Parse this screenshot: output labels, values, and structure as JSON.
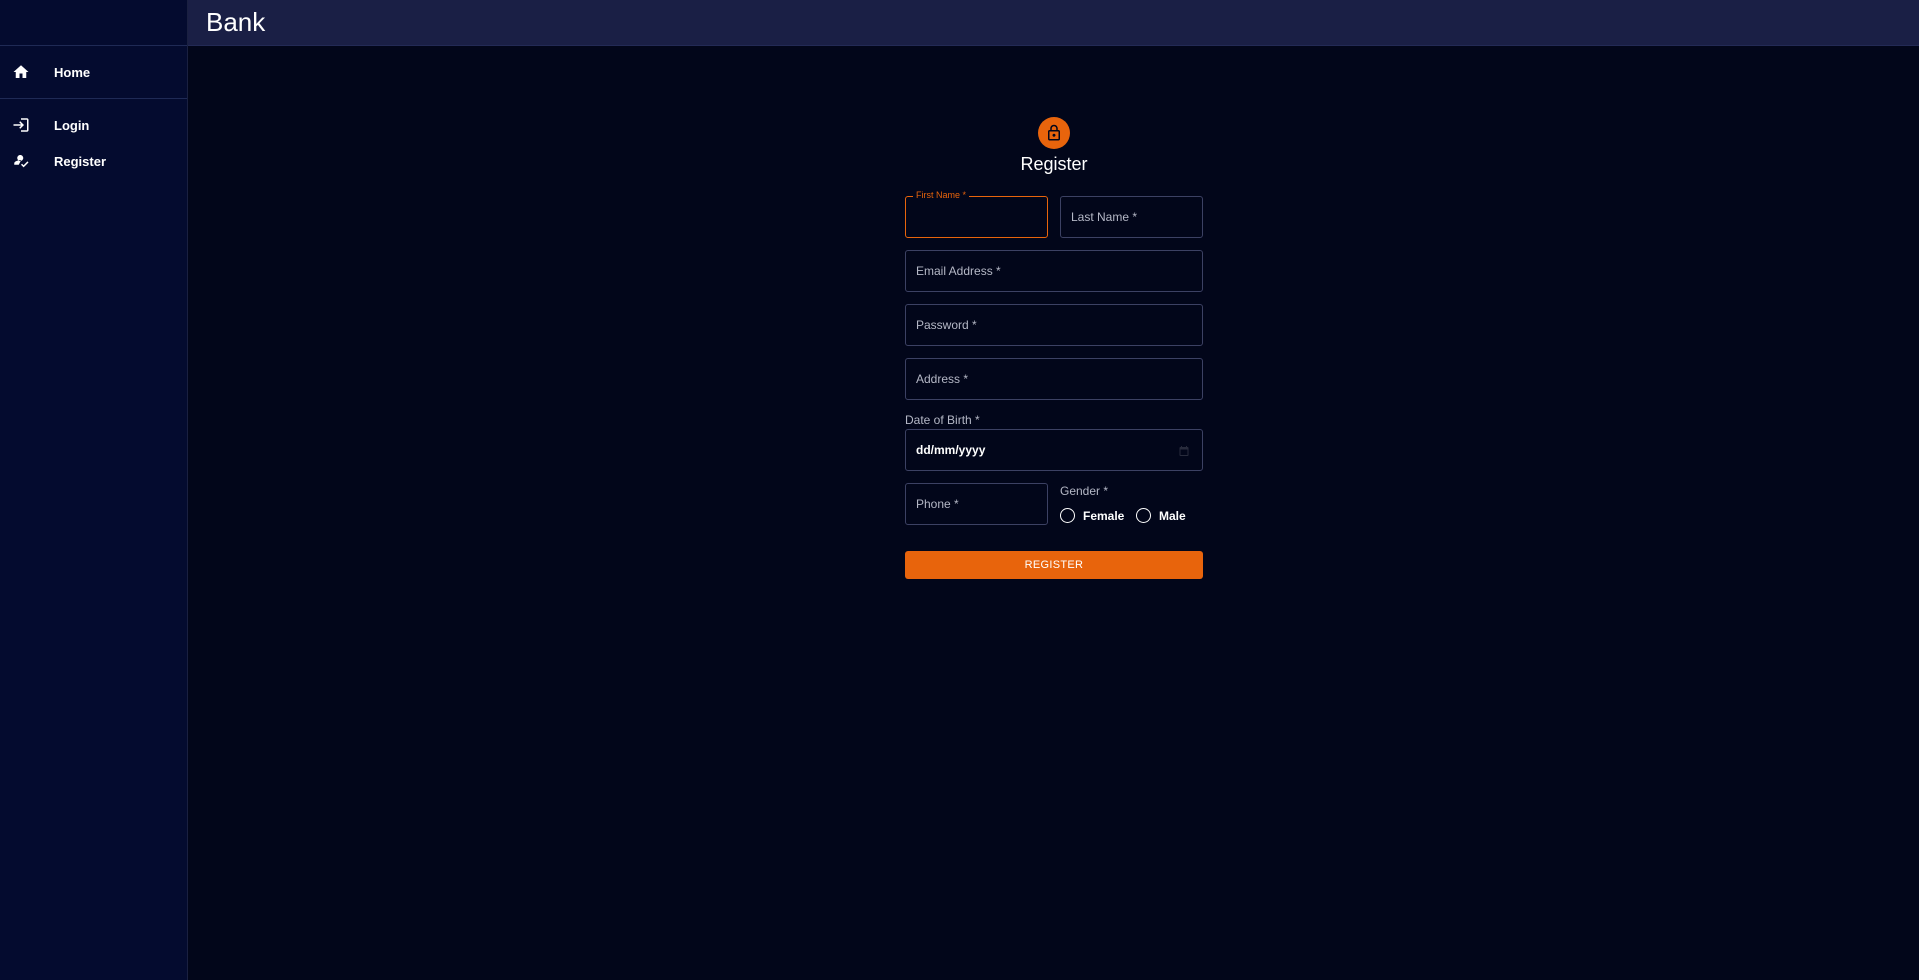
{
  "app": {
    "title": "Bank"
  },
  "sidebar": {
    "items": [
      {
        "label": "Home",
        "icon": "home-icon"
      },
      {
        "label": "Login",
        "icon": "login-icon"
      },
      {
        "label": "Register",
        "icon": "how-to-reg-icon"
      }
    ]
  },
  "form": {
    "title": "Register",
    "first_name": {
      "label": "First Name *",
      "value": ""
    },
    "last_name": {
      "placeholder": "Last Name *"
    },
    "email": {
      "placeholder": "Email Address *"
    },
    "password": {
      "placeholder": "Password *"
    },
    "address": {
      "placeholder": "Address *"
    },
    "dob": {
      "label": "Date of Birth *",
      "value": "dd/mm/yyyy"
    },
    "phone": {
      "placeholder": "Phone *"
    },
    "gender": {
      "label": "Gender *",
      "options": [
        "Female",
        "Male"
      ]
    },
    "submit_label": "REGISTER"
  },
  "colors": {
    "accent": "#e8640c",
    "background": "#02061a",
    "sidebar": "#040b2f",
    "appbar": "#1a1f45"
  }
}
